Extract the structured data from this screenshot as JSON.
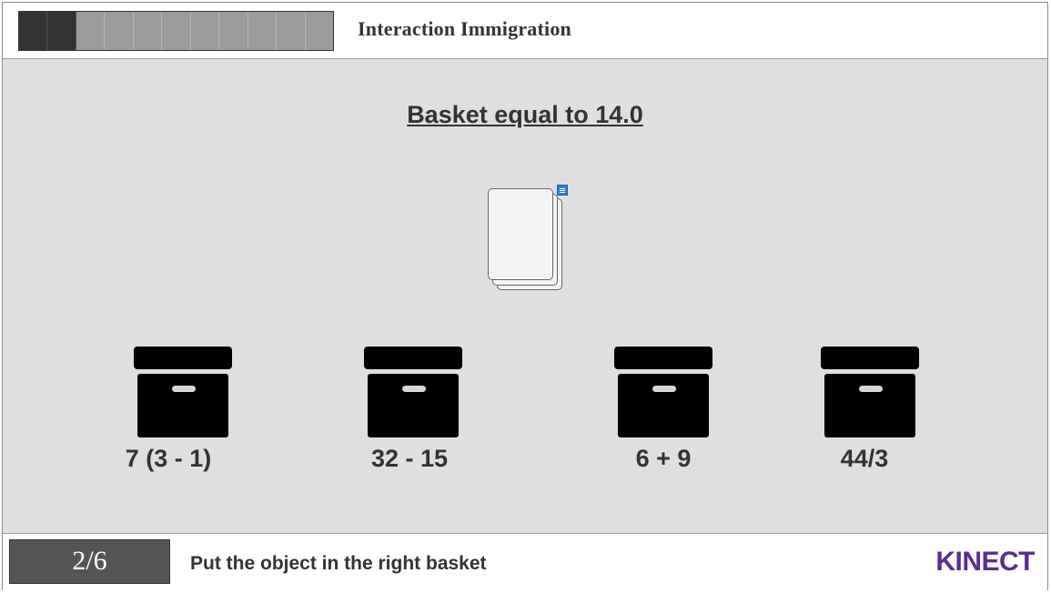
{
  "header": {
    "title": "Interaction Immigration",
    "progress": {
      "completed": 2,
      "total": 11
    }
  },
  "task": {
    "title": "Basket equal to 14.0",
    "object_icon": "stacked-cards-icon",
    "note_icon": "note-icon"
  },
  "baskets": [
    {
      "label": "7 (3 - 1)"
    },
    {
      "label": "32 - 15"
    },
    {
      "label": "6 + 9"
    },
    {
      "label": "44/3"
    }
  ],
  "footer": {
    "counter": "2/6",
    "hint": "Put the object in the right basket",
    "brand": "KINECT"
  },
  "colors": {
    "progress_done": "#333333",
    "progress_todo": "#9b9b9b",
    "stage_bg": "#dfdfdf",
    "brand": "#5a2d91"
  }
}
